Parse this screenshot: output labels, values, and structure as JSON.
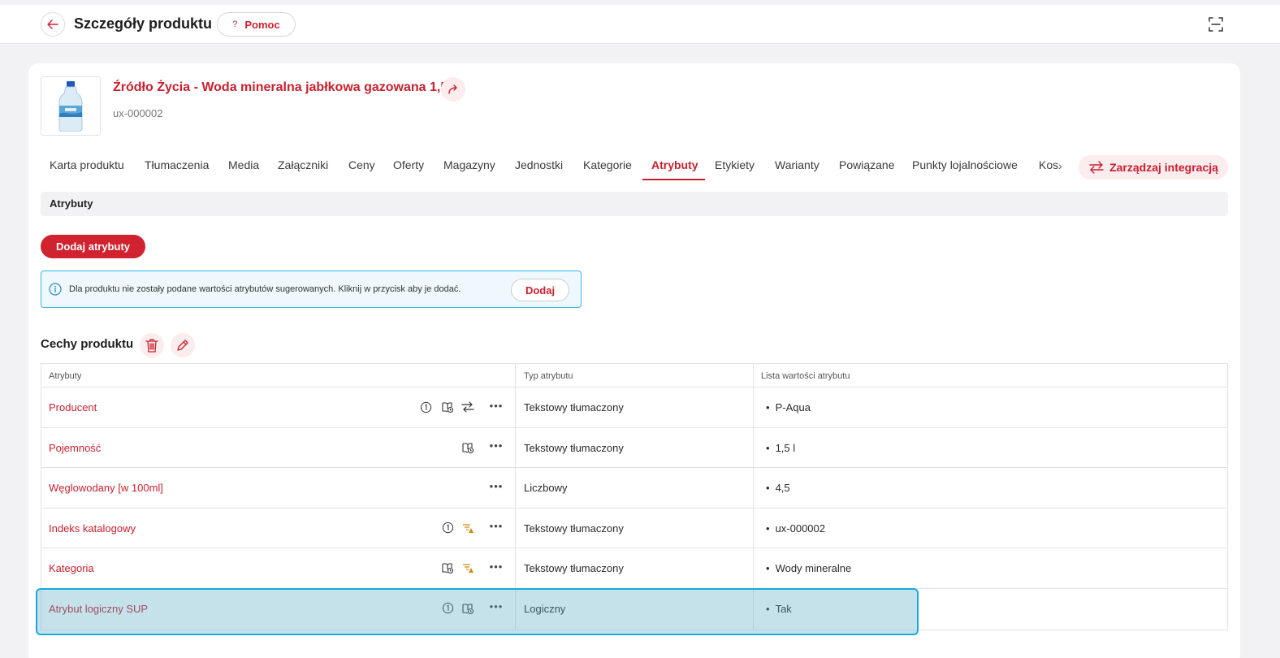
{
  "header": {
    "title": "Szczegóły produktu",
    "help_label": "Pomoc",
    "help_glyph": "?"
  },
  "product": {
    "name": "Źródło Życia - Woda mineralna jabłkowa gazowana 1,5l",
    "code": "ux-000002"
  },
  "tabs": [
    {
      "label": "Karta produktu"
    },
    {
      "label": "Tłumaczenia"
    },
    {
      "label": "Media"
    },
    {
      "label": "Załączniki"
    },
    {
      "label": "Ceny"
    },
    {
      "label": "Oferty"
    },
    {
      "label": "Magazyny"
    },
    {
      "label": "Jednostki"
    },
    {
      "label": "Kategorie"
    },
    {
      "label": "Atrybuty"
    },
    {
      "label": "Etykiety"
    },
    {
      "label": "Warianty"
    },
    {
      "label": "Powiązane"
    },
    {
      "label": "Punkty lojalnościowe"
    },
    {
      "label": "Kos"
    }
  ],
  "integration_label": "Zarządzaj integracją",
  "section_title": "Atrybuty",
  "add_attributes_label": "Dodaj atrybuty",
  "info": {
    "text": "Dla produktu nie zostały podane wartości atrybutów sugerowanych. Kliknij w przycisk aby je dodać.",
    "button_label": "Dodaj"
  },
  "features": {
    "title": "Cechy produktu",
    "columns": [
      "Atrybuty",
      "Typ atrybutu",
      "Lista wartości atrybutu"
    ],
    "rows": [
      {
        "name": "Producent",
        "type": "Tekstowy tłumaczony",
        "value": "P-Aqua",
        "icons": [
          "number-one-icon",
          "book-clock-icon",
          "transfer-arrows-icon"
        ]
      },
      {
        "name": "Pojemność",
        "type": "Tekstowy tłumaczony",
        "value": "1,5 l",
        "icons": [
          "book-clock-icon"
        ]
      },
      {
        "name": "Węglowodany [w 100ml]",
        "type": "Liczbowy",
        "value": "4,5",
        "icons": []
      },
      {
        "name": "Indeks katalogowy",
        "type": "Tekstowy tłumaczony",
        "value": "ux-000002",
        "icons": [
          "number-one-icon",
          "sort-warning-icon"
        ]
      },
      {
        "name": "Kategoria",
        "type": "Tekstowy tłumaczony",
        "value": "Wody mineralne",
        "icons": [
          "book-clock-icon",
          "sort-warning-icon"
        ]
      },
      {
        "name": "Atrybut logiczny SUP",
        "type": "Logiczny",
        "value": "Tak",
        "icons": [
          "number-one-icon",
          "book-clock-icon"
        ]
      }
    ]
  },
  "colors": {
    "accent": "#d0222f",
    "info_border": "#3ab4e0",
    "warning_icon": "#d08a12",
    "selection_border": "#1aa9df"
  }
}
